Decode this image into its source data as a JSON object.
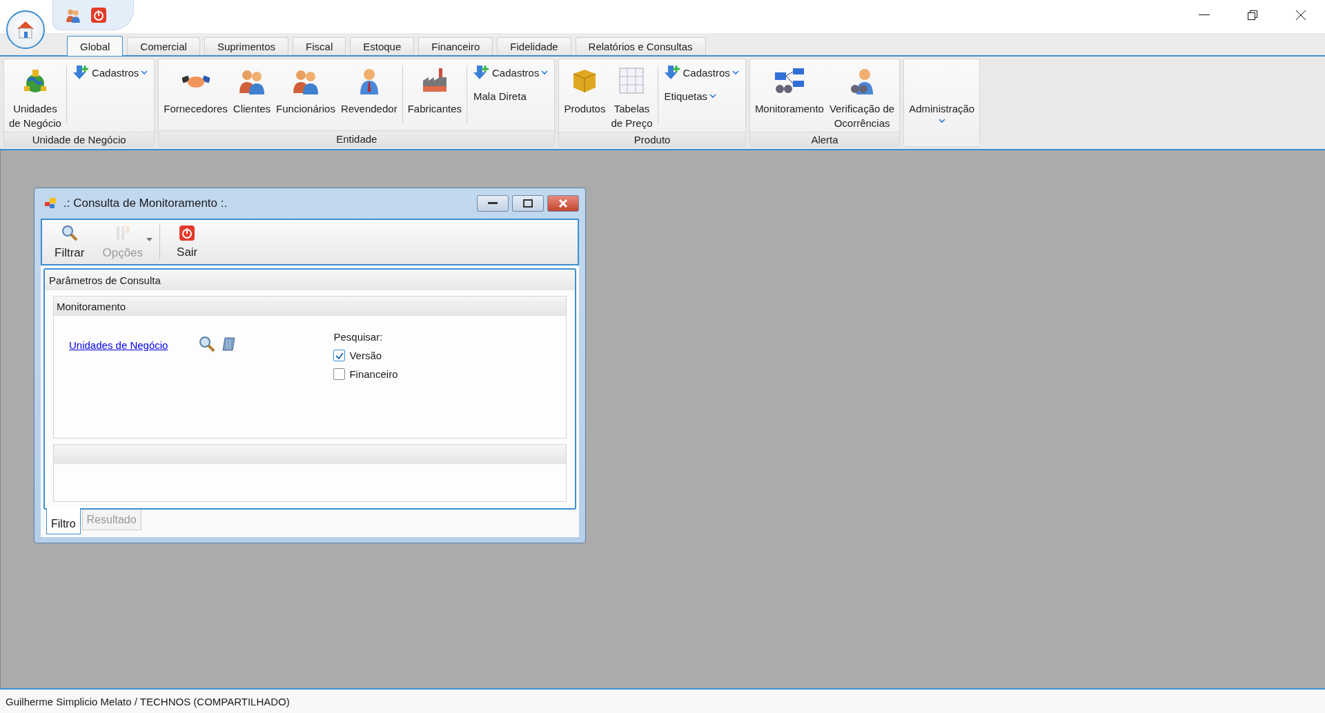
{
  "quick_access": [
    {
      "kind": "button"
    },
    {
      "kind": "button"
    }
  ],
  "tabs": [
    {
      "label": "Global",
      "selected": true
    },
    {
      "label": "Comercial",
      "selected": false
    },
    {
      "label": "Suprimentos",
      "selected": false
    },
    {
      "label": "Fiscal",
      "selected": false
    },
    {
      "label": "Estoque",
      "selected": false
    },
    {
      "label": "Financeiro",
      "selected": false
    },
    {
      "label": "Fidelidade",
      "selected": false
    },
    {
      "label": "Relatórios e Consultas",
      "selected": false
    }
  ],
  "ribbon_groups": [
    {
      "title": "Unidade de Negócio",
      "columns": [
        [
          {
            "kind": "large",
            "label": "Unidades\nde Negócio"
          }
        ],
        [
          {
            "kind": "separator"
          }
        ],
        [
          {
            "kind": "small",
            "label": "Cadastros",
            "dropdown": true
          }
        ]
      ]
    },
    {
      "title": "Entidade",
      "columns": [
        [
          {
            "kind": "large",
            "label": "Fornecedores"
          }
        ],
        [
          {
            "kind": "large",
            "label": "Clientes"
          }
        ],
        [
          {
            "kind": "large",
            "label": "Funcionários"
          }
        ],
        [
          {
            "kind": "large",
            "label": "Revendedor"
          }
        ],
        [
          {
            "kind": "separator"
          }
        ],
        [
          {
            "kind": "large",
            "label": "Fabricantes"
          }
        ],
        [
          {
            "kind": "separator"
          }
        ],
        [
          {
            "kind": "small",
            "label": "Cadastros",
            "dropdown": true
          },
          {
            "kind": "small",
            "label": "Mala Direta",
            "dropdown": false
          }
        ]
      ]
    },
    {
      "title": "Produto",
      "columns": [
        [
          {
            "kind": "large",
            "label": "Produtos"
          }
        ],
        [
          {
            "kind": "large",
            "label": "Tabelas\nde Preço"
          }
        ],
        [
          {
            "kind": "separator"
          }
        ],
        [
          {
            "kind": "small",
            "label": "Cadastros",
            "dropdown": true
          },
          {
            "kind": "small",
            "label": "Etiquetas",
            "dropdown": true
          }
        ]
      ]
    },
    {
      "title": "Alerta",
      "columns": [
        [
          {
            "kind": "large",
            "label": "Monitoramento"
          }
        ],
        [
          {
            "kind": "large",
            "label": "Verificação de\nOcorrências"
          }
        ]
      ]
    },
    {
      "columns": [
        [
          {
            "kind": "large",
            "label": "Administração",
            "dropdown": true
          }
        ]
      ]
    }
  ],
  "dialog": {
    "title": ".: Consulta de Monitoramento :.",
    "toolbar": [
      {
        "kind": "button",
        "label": "Filtrar",
        "disabled": false,
        "dropdown": false
      },
      {
        "kind": "button",
        "label": "Opções",
        "disabled": true,
        "dropdown": true
      },
      {
        "kind": "separator"
      },
      {
        "kind": "button",
        "label": "Sair",
        "disabled": false,
        "dropdown": false
      }
    ],
    "panel_title": "Parâmetros de Consulta",
    "group_title": "Monitoramento",
    "link": "Unidades de Negócio",
    "search_label": "Pesquisar:",
    "checkboxes": [
      {
        "label": "Versão",
        "checked": true
      },
      {
        "label": "Financeiro",
        "checked": false
      }
    ],
    "bottom_tabs": [
      {
        "label": "Filtro",
        "selected": true
      },
      {
        "label": "Resultado",
        "selected": false
      }
    ]
  },
  "status_bar": "Guilherme Simplicio Melato / TECHNOS (COMPARTILHADO)"
}
